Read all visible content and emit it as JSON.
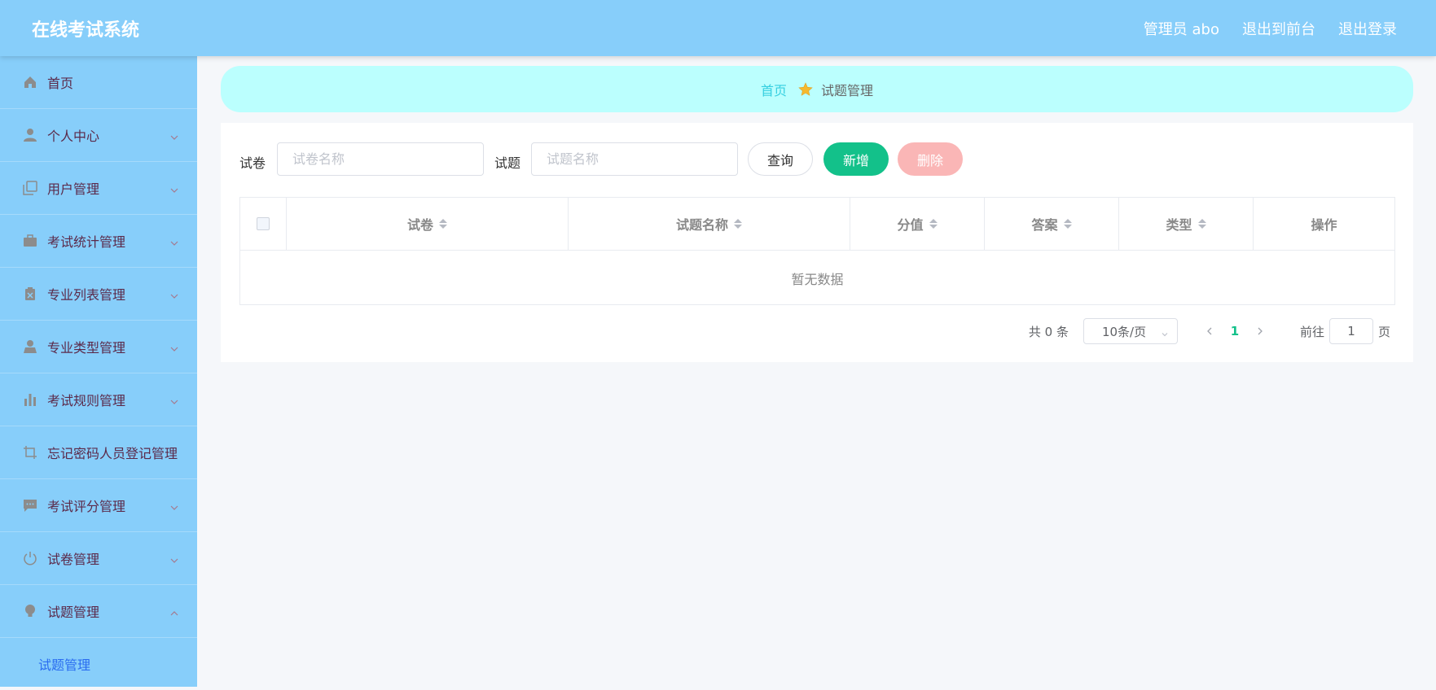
{
  "header": {
    "app_title": "在线考试系统",
    "user": "管理员 abo",
    "to_front": "退出到前台",
    "logout": "退出登录"
  },
  "colors": {
    "header_bg": "#87cefa",
    "sidebar_bg": "#87cefa",
    "breadcrumb_bg": "#bbfffe",
    "add_button": "#13c18a",
    "delete_button": "#fab6b6",
    "active_page": "#13c18a"
  },
  "sidebar": {
    "items": [
      {
        "label": "首页",
        "icon": "home-icon",
        "expandable": false
      },
      {
        "label": "个人中心",
        "icon": "user-icon",
        "expandable": true
      },
      {
        "label": "用户管理",
        "icon": "copy-icon",
        "expandable": true
      },
      {
        "label": "考试统计管理",
        "icon": "briefcase-icon",
        "expandable": true
      },
      {
        "label": "专业列表管理",
        "icon": "clipboard-icon",
        "expandable": true
      },
      {
        "label": "专业类型管理",
        "icon": "person-icon",
        "expandable": true
      },
      {
        "label": "考试规则管理",
        "icon": "bar-chart-icon",
        "expandable": true
      },
      {
        "label": "忘记密码人员登记管理",
        "icon": "crop-icon",
        "expandable": false
      },
      {
        "label": "考试评分管理",
        "icon": "message-icon",
        "expandable": true
      },
      {
        "label": "试卷管理",
        "icon": "power-icon",
        "expandable": true
      },
      {
        "label": "试题管理",
        "icon": "bulb-icon",
        "expandable": true,
        "expanded": true
      }
    ],
    "sub_item": "试题管理"
  },
  "breadcrumb": {
    "home": "首页",
    "current": "试题管理",
    "separator_icon": "star-icon"
  },
  "filters": {
    "paper_label": "试卷",
    "paper_placeholder": "试卷名称",
    "paper_value": "",
    "question_label": "试题",
    "question_placeholder": "试题名称",
    "question_value": "",
    "query_button": "查询",
    "add_button": "新增",
    "delete_button": "删除"
  },
  "table": {
    "columns": [
      "试卷",
      "试题名称",
      "分值",
      "答案",
      "类型",
      "操作"
    ],
    "empty_text": "暂无数据",
    "rows": []
  },
  "pagination": {
    "total_text": "共 0 条",
    "page_size": "10条/页",
    "current_page": "1",
    "goto_label": "前往",
    "goto_value": "1",
    "page_suffix": "页"
  }
}
